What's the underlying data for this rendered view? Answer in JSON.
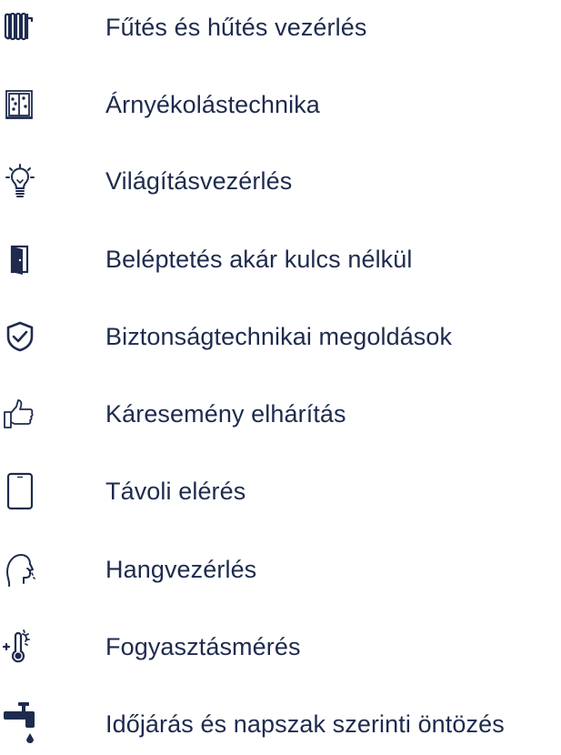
{
  "colors": {
    "text": "#1e2b4e",
    "icon": "#1e2b4e",
    "background": "#ffffff"
  },
  "items": [
    {
      "icon": "radiator-icon",
      "label": "Fűtés és hűtés vezérlés"
    },
    {
      "icon": "window-shutter-icon",
      "label": "Árnyékolástechnika"
    },
    {
      "icon": "light-bulb-icon",
      "label": "Világításvezérlés"
    },
    {
      "icon": "door-icon",
      "label": "Beléptetés akár kulcs nélkül"
    },
    {
      "icon": "shield-check-icon",
      "label": "Biztonságtechnikai megoldások"
    },
    {
      "icon": "thumbs-up-icon",
      "label": "Káresemény elhárítás"
    },
    {
      "icon": "tablet-icon",
      "label": "Távoli elérés"
    },
    {
      "icon": "voice-head-icon",
      "label": "Hangvezérlés"
    },
    {
      "icon": "thermometer-icon",
      "label": "Fogyasztásmérés"
    },
    {
      "icon": "water-tap-icon",
      "label": "Időjárás és napszak szerinti öntözés"
    }
  ]
}
